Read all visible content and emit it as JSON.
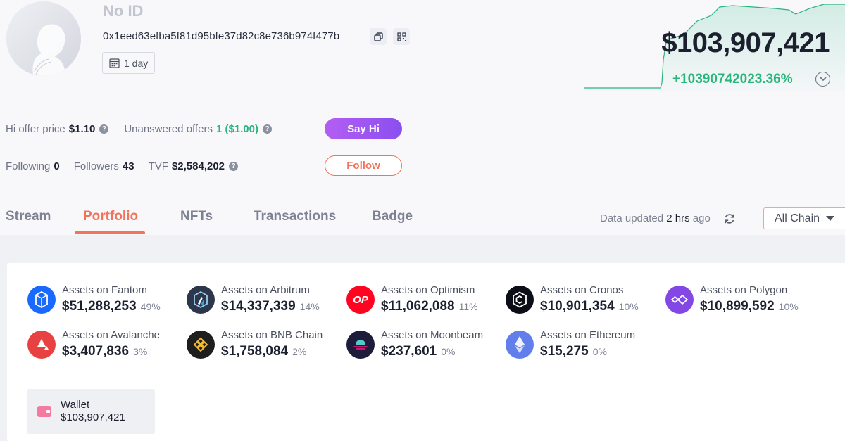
{
  "profile": {
    "name": "No ID",
    "address": "0x1eed63efba5f81d95bfe37d82c8e736b974f477b",
    "period_label": "1 day"
  },
  "balance": {
    "total": "$103,907,421",
    "change": "+10390742023.36%",
    "accent_color": "#2ab57d"
  },
  "social": {
    "hi_offer_label": "Hi offer price",
    "hi_offer_value": "$1.10",
    "unanswered_label": "Unanswered offers",
    "unanswered_value": "1 ($1.00)",
    "say_hi_label": "Say Hi",
    "following_label": "Following",
    "following_value": "0",
    "followers_label": "Followers",
    "followers_value": "43",
    "tvf_label": "TVF",
    "tvf_value": "$2,584,202",
    "follow_label": "Follow"
  },
  "tabs": [
    {
      "label": "Stream"
    },
    {
      "label": "Portfolio",
      "active": true
    },
    {
      "label": "NFTs"
    },
    {
      "label": "Transactions"
    },
    {
      "label": "Badge"
    }
  ],
  "toolbar": {
    "updated_prefix": "Data updated",
    "updated_value": "2 hrs",
    "updated_suffix": "ago",
    "chain_select": "All Chain"
  },
  "assets": [
    {
      "label": "Assets on Fantom",
      "value": "$51,288,253",
      "pct": "49%",
      "icon": "fantom-icon",
      "color": "#1969ff"
    },
    {
      "label": "Assets on Arbitrum",
      "value": "$14,337,339",
      "pct": "14%",
      "icon": "arbitrum-icon",
      "color": "#2d374b"
    },
    {
      "label": "Assets on Optimism",
      "value": "$11,062,088",
      "pct": "11%",
      "icon": "optimism-icon",
      "color": "#ff0420",
      "glyph": "OP"
    },
    {
      "label": "Assets on Cronos",
      "value": "$10,901,354",
      "pct": "10%",
      "icon": "cronos-icon",
      "color": "#0b0d17"
    },
    {
      "label": "Assets on Polygon",
      "value": "$10,899,592",
      "pct": "10%",
      "icon": "polygon-icon",
      "color": "#8247e5"
    },
    {
      "label": "Assets on Avalanche",
      "value": "$3,407,836",
      "pct": "3%",
      "icon": "avalanche-icon",
      "color": "#e84142"
    },
    {
      "label": "Assets on BNB Chain",
      "value": "$1,758,084",
      "pct": "2%",
      "icon": "bnb-chain-icon",
      "color": "#1e1e1e"
    },
    {
      "label": "Assets on Moonbeam",
      "value": "$237,601",
      "pct": "0%",
      "icon": "moonbeam-icon",
      "color": "#1d1c3a"
    },
    {
      "label": "Assets on Ethereum",
      "value": "$15,275",
      "pct": "0%",
      "icon": "ethereum-icon",
      "color": "#627eea"
    }
  ],
  "wallet": {
    "label": "Wallet",
    "value": "$103,907,421",
    "icon": "wallet-icon"
  }
}
